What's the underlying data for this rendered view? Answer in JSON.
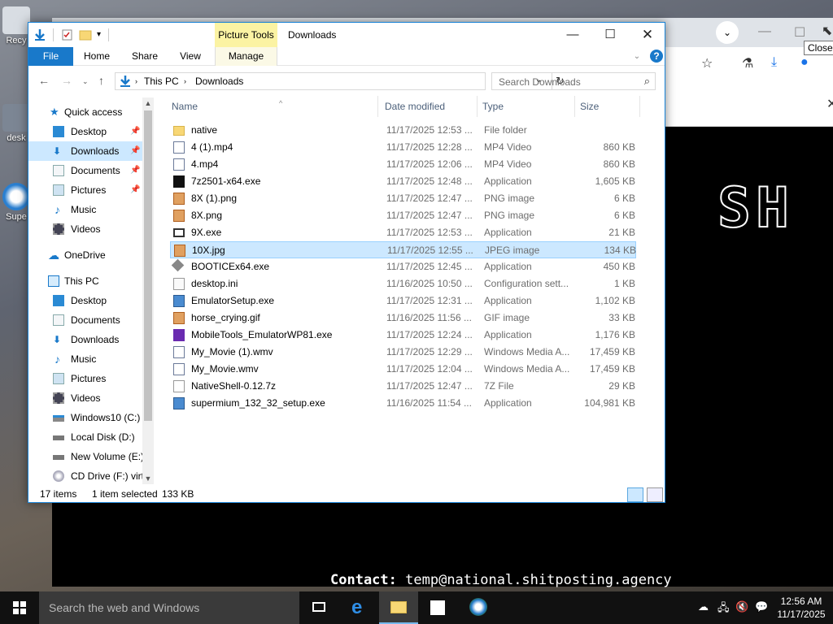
{
  "desktop": {
    "icons": [
      {
        "label": "Recy"
      },
      {
        "label": "desk"
      },
      {
        "label": "Supe"
      }
    ]
  },
  "browser": {
    "tooltip": "Close",
    "banner_text": "SH",
    "contact_label": "Contact:",
    "contact_value": "temp@national.shitposting.agency"
  },
  "explorer": {
    "context_tab": "Picture Tools",
    "title": "Downloads",
    "ribbon_tabs": [
      "File",
      "Home",
      "Share",
      "View",
      "Manage"
    ],
    "address": [
      "This PC",
      "Downloads"
    ],
    "search_placeholder": "Search Downloads",
    "nav": {
      "quick_access": "Quick access",
      "qa_items": [
        "Desktop",
        "Downloads",
        "Documents",
        "Pictures",
        "Music",
        "Videos"
      ],
      "onedrive": "OneDrive",
      "this_pc": "This PC",
      "pc_items": [
        "Desktop",
        "Documents",
        "Downloads",
        "Music",
        "Pictures",
        "Videos",
        "Windows10 (C:)",
        "Local Disk (D:)",
        "New Volume (E:)",
        "CD Drive (F:) virt"
      ]
    },
    "columns": [
      "Name",
      "Date modified",
      "Type",
      "Size"
    ],
    "files": [
      {
        "name": "native",
        "date": "11/17/2025 12:53 ...",
        "type": "File folder",
        "size": "",
        "icon": "folder-icon"
      },
      {
        "name": "4 (1).mp4",
        "date": "11/17/2025 12:28 ...",
        "type": "MP4 Video",
        "size": "860 KB",
        "icon": "video-file-icon"
      },
      {
        "name": "4.mp4",
        "date": "11/17/2025 12:06 ...",
        "type": "MP4 Video",
        "size": "860 KB",
        "icon": "video-file-icon"
      },
      {
        "name": "7z2501-x64.exe",
        "date": "11/17/2025 12:48 ...",
        "type": "Application",
        "size": "1,605 KB",
        "icon": "7zip-icon"
      },
      {
        "name": "8X (1).png",
        "date": "11/17/2025 12:47 ...",
        "type": "PNG image",
        "size": "6 KB",
        "icon": "image-file-icon"
      },
      {
        "name": "8X.png",
        "date": "11/17/2025 12:47 ...",
        "type": "PNG image",
        "size": "6 KB",
        "icon": "image-file-icon"
      },
      {
        "name": "9X.exe",
        "date": "11/17/2025 12:53 ...",
        "type": "Application",
        "size": "21 KB",
        "icon": "exe-icon"
      },
      {
        "name": "10X.jpg",
        "date": "11/17/2025 12:55 ...",
        "type": "JPEG image",
        "size": "134 KB",
        "icon": "image-file-icon"
      },
      {
        "name": "BOOTICEx64.exe",
        "date": "11/17/2025 12:45 ...",
        "type": "Application",
        "size": "450 KB",
        "icon": "bootice-icon"
      },
      {
        "name": "desktop.ini",
        "date": "11/16/2025 10:50 ...",
        "type": "Configuration sett...",
        "size": "1 KB",
        "icon": "ini-file-icon"
      },
      {
        "name": "EmulatorSetup.exe",
        "date": "11/17/2025 12:31 ...",
        "type": "Application",
        "size": "1,102 KB",
        "icon": "setup-icon"
      },
      {
        "name": "horse_crying.gif",
        "date": "11/16/2025 11:56 ...",
        "type": "GIF image",
        "size": "33 KB",
        "icon": "image-file-icon"
      },
      {
        "name": "MobileTools_EmulatorWP81.exe",
        "date": "11/17/2025 12:24 ...",
        "type": "Application",
        "size": "1,176 KB",
        "icon": "visual-studio-icon"
      },
      {
        "name": "My_Movie (1).wmv",
        "date": "11/17/2025 12:29 ...",
        "type": "Windows Media A...",
        "size": "17,459 KB",
        "icon": "video-file-icon"
      },
      {
        "name": "My_Movie.wmv",
        "date": "11/17/2025 12:04 ...",
        "type": "Windows Media A...",
        "size": "17,459 KB",
        "icon": "video-file-icon"
      },
      {
        "name": "NativeShell-0.12.7z",
        "date": "11/17/2025 12:47 ...",
        "type": "7Z File",
        "size": "29 KB",
        "icon": "blank-file-icon"
      },
      {
        "name": "supermium_132_32_setup.exe",
        "date": "11/16/2025 11:54 ...",
        "type": "Application",
        "size": "104,981 KB",
        "icon": "setup-icon"
      }
    ],
    "status": {
      "count": "17 items",
      "selected": "1 item selected",
      "selected_size": "133 KB"
    }
  },
  "taskbar": {
    "search_placeholder": "Search the web and Windows",
    "time": "12:56 AM",
    "date": "11/17/2025"
  }
}
